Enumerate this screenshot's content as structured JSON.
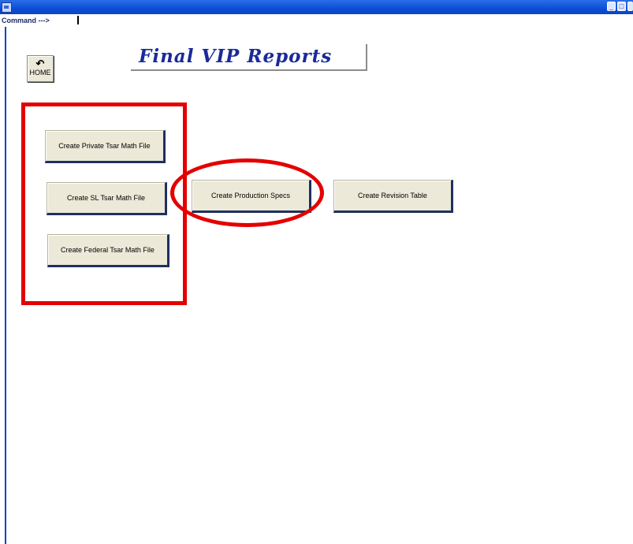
{
  "window": {
    "command_label": "Command --->",
    "controls": [
      "minimize-icon",
      "maximize-icon",
      "close-icon"
    ]
  },
  "home": {
    "icon": "return-arrow-icon",
    "label": "HOME"
  },
  "page": {
    "title": "Final VIP Reports"
  },
  "buttons": {
    "private": "Create Private Tsar Math File",
    "sl": "Create SL Tsar Math File",
    "federal": "Create Federal Tsar Math File",
    "production_specs": "Create Production Specs",
    "revision_table": "Create Revision Table"
  },
  "colors": {
    "annotation": "#e40000",
    "title": "#1a2a9a",
    "titlebar": "#0b4fd6",
    "button_face": "#ece9d8"
  }
}
